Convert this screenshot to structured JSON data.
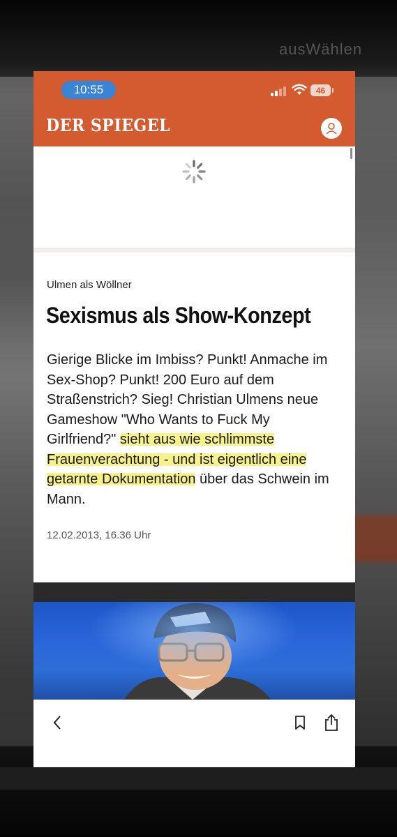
{
  "status_bar": {
    "time": "10:55",
    "battery": "46"
  },
  "header": {
    "logo": "DER SPIEGEL",
    "account_icon": "user-icon",
    "color": "#d45a2f"
  },
  "background": {
    "blurred_title": "ausWählen"
  },
  "article": {
    "kicker": "Ulmen als Wöllner",
    "headline": "Sexismus als Show-Konzept",
    "teaser": {
      "p1": "Gierige Blicke im Imbiss? Punkt! Anmache im Sex-Shop? Punkt! 200 Euro auf dem Straßenstrich? Sieg! Christian Ulmens neue Gameshow \"Who Wants to Fuck My Girlfriend?\" ",
      "p2": "sieht aus wie schlimmste Frauenverachtung - und ist eigentlich eine getarnte Dokumentation",
      "p3": " über das Schwein im Mann."
    },
    "date": "12.02.2013, 16.36 Uhr",
    "highlight_color": "#f7f28a"
  },
  "toolbar": {
    "back_icon": "chevron-left-icon",
    "bookmark_icon": "bookmark-icon",
    "share_icon": "share-icon"
  }
}
